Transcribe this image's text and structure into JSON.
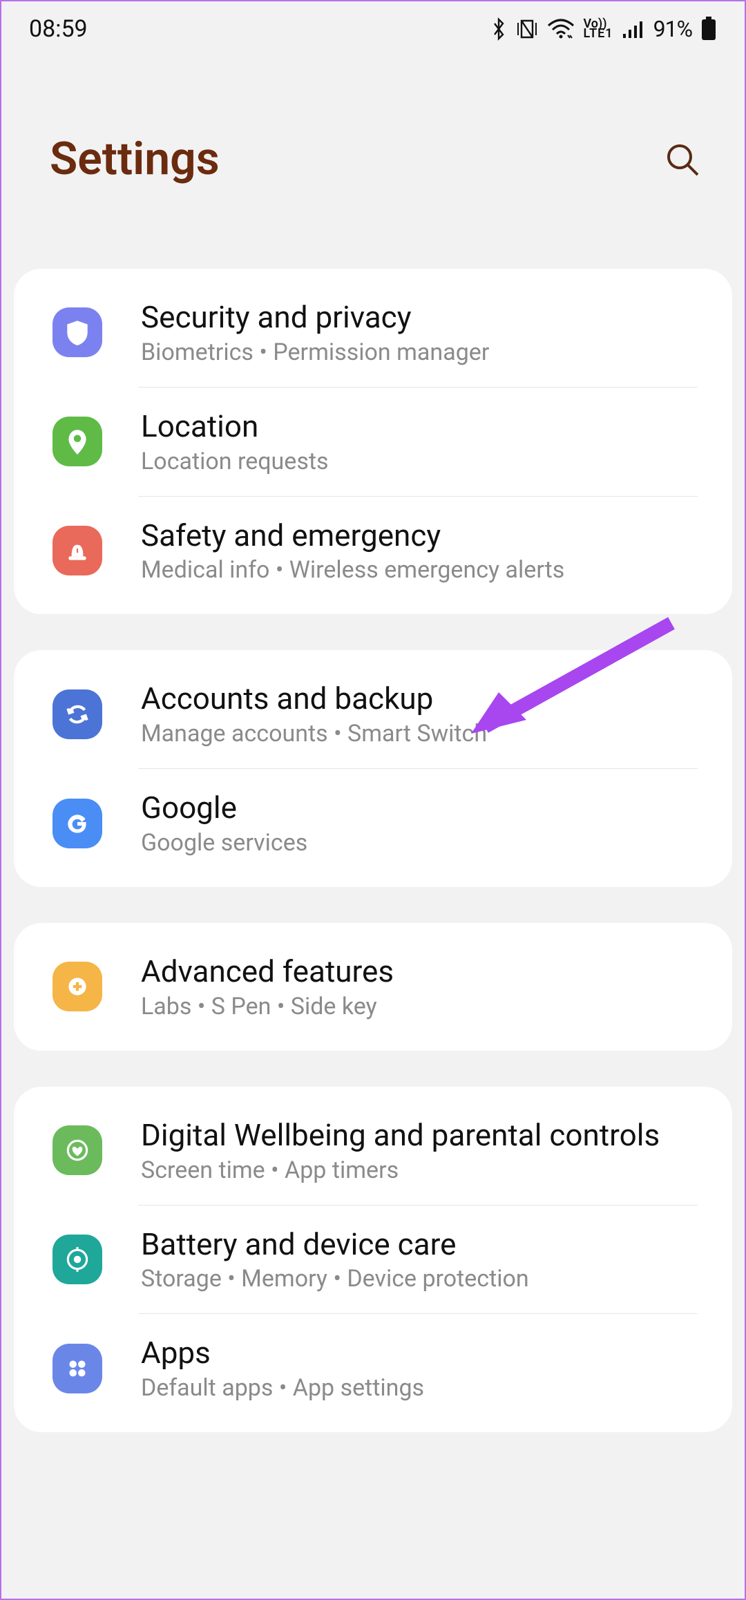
{
  "status": {
    "time": "08:59",
    "battery": "91%"
  },
  "header": {
    "title": "Settings"
  },
  "groups": [
    {
      "items": [
        {
          "title": "Security and privacy",
          "subtitle": "Biometrics  •  Permission manager"
        },
        {
          "title": "Location",
          "subtitle": "Location requests"
        },
        {
          "title": "Safety and emergency",
          "subtitle": "Medical info  •  Wireless emergency alerts"
        }
      ]
    },
    {
      "items": [
        {
          "title": "Accounts and backup",
          "subtitle": "Manage accounts  •  Smart Switch"
        },
        {
          "title": "Google",
          "subtitle": "Google services"
        }
      ]
    },
    {
      "items": [
        {
          "title": "Advanced features",
          "subtitle": "Labs  •  S Pen  •  Side key"
        }
      ]
    },
    {
      "items": [
        {
          "title": "Digital Wellbeing and parental controls",
          "subtitle": "Screen time  •  App timers"
        },
        {
          "title": "Battery and device care",
          "subtitle": "Storage  •  Memory  •  Device protection"
        },
        {
          "title": "Apps",
          "subtitle": "Default apps  •  App settings"
        }
      ]
    }
  ]
}
